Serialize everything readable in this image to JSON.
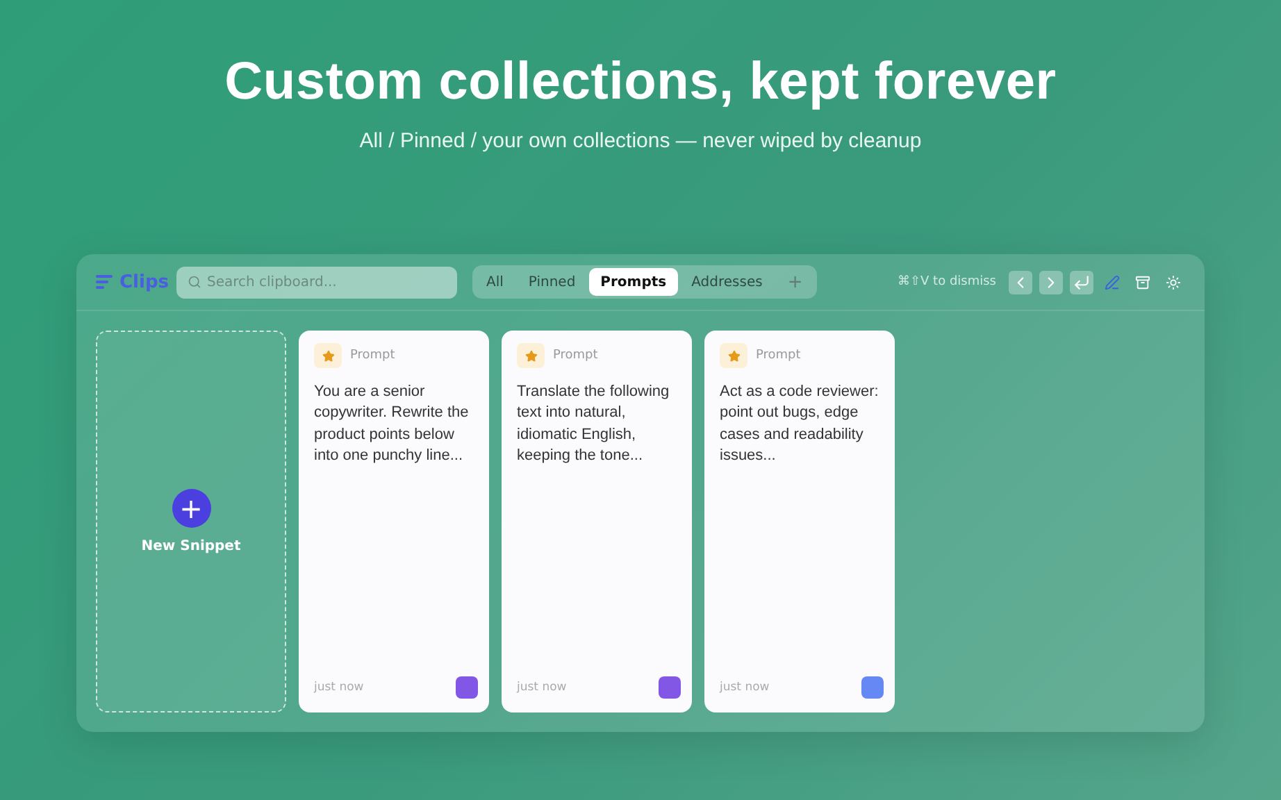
{
  "hero": {
    "title": "Custom collections, kept forever",
    "subtitle": "All / Pinned / your own collections — never wiped by cleanup"
  },
  "toolbar": {
    "app_name": "Clips",
    "search": {
      "placeholder": "Search clipboard..."
    },
    "tabs": [
      {
        "label": "All",
        "selected": false
      },
      {
        "label": "Pinned",
        "selected": false
      },
      {
        "label": "Prompts",
        "selected": true
      },
      {
        "label": "Addresses",
        "selected": false
      }
    ],
    "add_tab": "+",
    "hint": "⌘⇧V to dismiss",
    "actions": [
      {
        "kind": "prev"
      },
      {
        "kind": "next"
      },
      {
        "kind": "enter"
      },
      {
        "kind": "pen"
      },
      {
        "kind": "archive"
      },
      {
        "kind": "sun"
      }
    ]
  },
  "new_snippet": {
    "icon": "+",
    "label": "New Snippet"
  },
  "cards": [
    {
      "tag": "Prompt",
      "text": "You are a senior copywriter. Rewrite the product points below into one punchy line...",
      "time": "just now",
      "color": "#8257e6"
    },
    {
      "tag": "Prompt",
      "text": "Translate the following text into natural, idiomatic English, keeping the tone...",
      "time": "just now",
      "color": "#8257e6"
    },
    {
      "tag": "Prompt",
      "text": "Act as a code reviewer: point out bugs, edge cases and readability issues...",
      "time": "just now",
      "color": "#6688f5"
    }
  ]
}
